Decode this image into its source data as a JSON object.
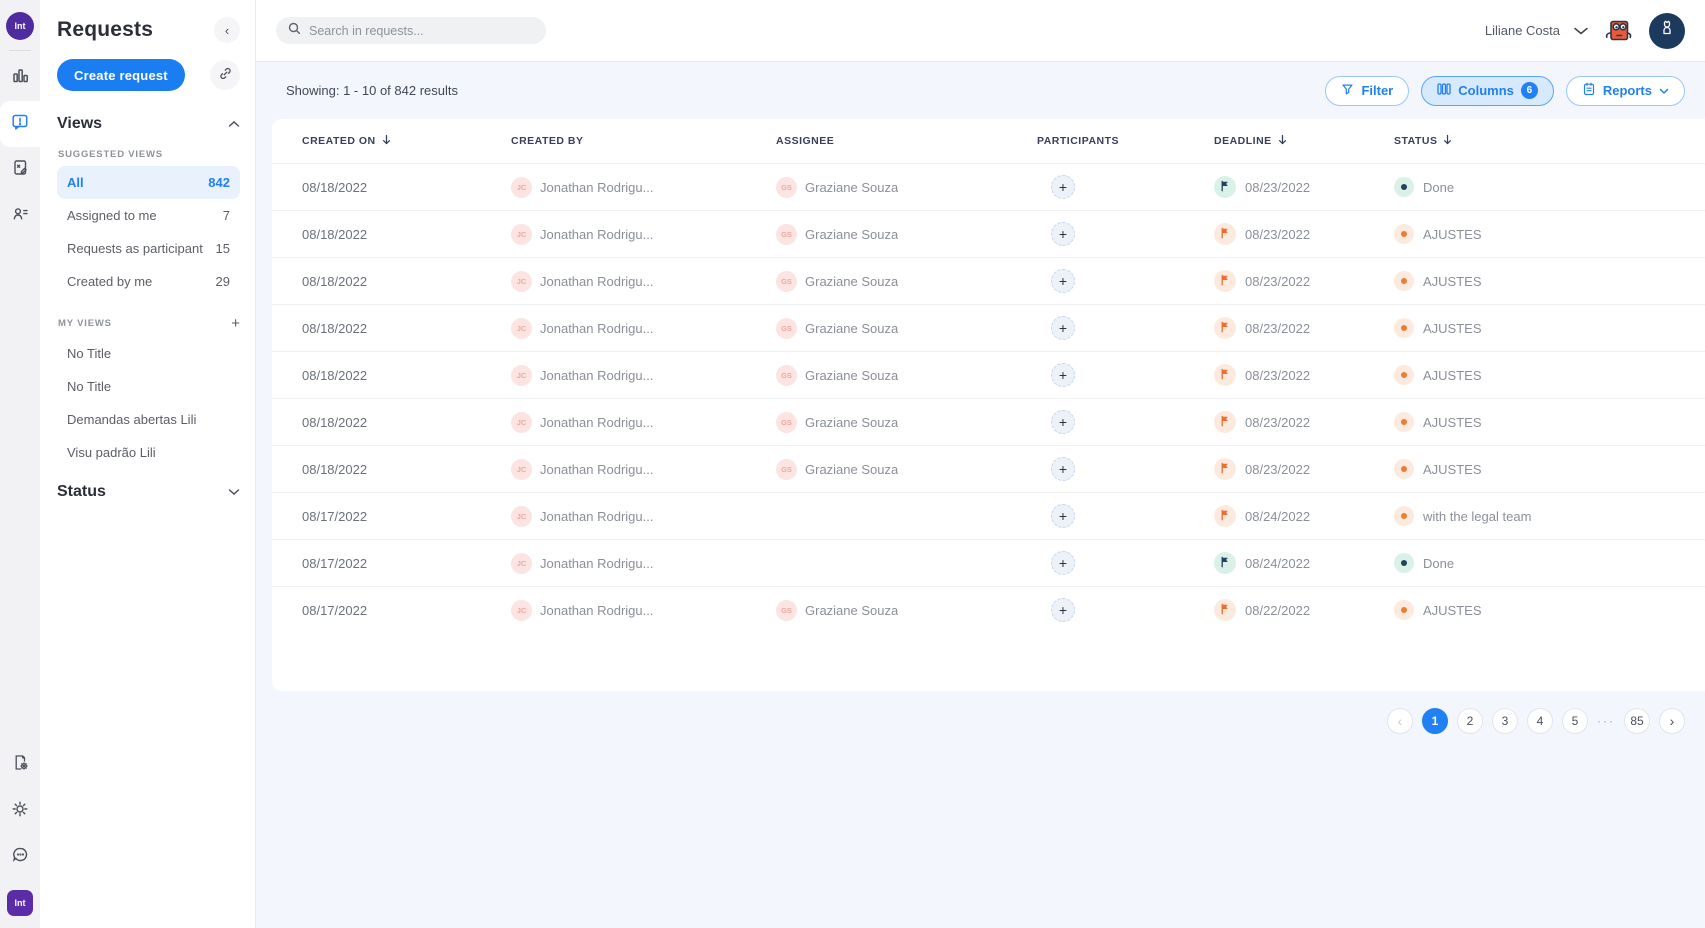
{
  "brand": {
    "logo_text": "lnt"
  },
  "rail": {
    "items": [
      {
        "icon": "bar-chart-icon",
        "active": false
      },
      {
        "icon": "requests-bubble-icon",
        "active": true
      },
      {
        "icon": "document-edit-icon",
        "active": false
      },
      {
        "icon": "contacts-icon",
        "active": false
      }
    ],
    "bottom_items": [
      {
        "icon": "document-gear-icon"
      },
      {
        "icon": "gear-icon"
      },
      {
        "icon": "chat-dots-icon"
      }
    ]
  },
  "sidebar": {
    "title": "Requests",
    "collapse_icon": "‹",
    "create_button": "Create request",
    "views_heading": "Views",
    "suggested_views_label": "SUGGESTED VIEWS",
    "suggested_views": [
      {
        "label": "All",
        "count": "842",
        "active": true
      },
      {
        "label": "Assigned to me",
        "count": "7",
        "active": false
      },
      {
        "label": "Requests as participant",
        "count": "15",
        "active": false
      },
      {
        "label": "Created by me",
        "count": "29",
        "active": false
      }
    ],
    "my_views_label": "MY VIEWS",
    "my_views_add": "+",
    "my_views": [
      "No Title",
      "No Title",
      "Demandas abertas Lili",
      "Visu padrão Lili"
    ],
    "status_heading": "Status"
  },
  "topbar": {
    "search_placeholder": "Search in requests...",
    "user_name": "Liliane Costa"
  },
  "toolbar": {
    "showing_text": "Showing: 1 - 10 of 842 results",
    "filter_label": "Filter",
    "columns_label": "Columns",
    "columns_count": "6",
    "reports_label": "Reports"
  },
  "table": {
    "columns": [
      {
        "label": "CREATED ON",
        "sortable": true
      },
      {
        "label": "CREATED BY",
        "sortable": false
      },
      {
        "label": "ASSIGNEE",
        "sortable": false
      },
      {
        "label": "PARTICIPANTS",
        "sortable": false
      },
      {
        "label": "DEADLINE",
        "sortable": true
      },
      {
        "label": "STATUS",
        "sortable": true
      }
    ],
    "rows": [
      {
        "created_on": "08/18/2022",
        "created_by": {
          "initials": "JC",
          "name": "Jonathan Rodrigu..."
        },
        "assignee": {
          "initials": "GS",
          "name": "Graziane Souza"
        },
        "deadline": "08/23/2022",
        "status": {
          "label": "Done",
          "type": "done"
        }
      },
      {
        "created_on": "08/18/2022",
        "created_by": {
          "initials": "JC",
          "name": "Jonathan Rodrigu..."
        },
        "assignee": {
          "initials": "GS",
          "name": "Graziane Souza"
        },
        "deadline": "08/23/2022",
        "status": {
          "label": "AJUSTES",
          "type": "orange"
        }
      },
      {
        "created_on": "08/18/2022",
        "created_by": {
          "initials": "JC",
          "name": "Jonathan Rodrigu..."
        },
        "assignee": {
          "initials": "GS",
          "name": "Graziane Souza"
        },
        "deadline": "08/23/2022",
        "status": {
          "label": "AJUSTES",
          "type": "orange"
        }
      },
      {
        "created_on": "08/18/2022",
        "created_by": {
          "initials": "JC",
          "name": "Jonathan Rodrigu..."
        },
        "assignee": {
          "initials": "GS",
          "name": "Graziane Souza"
        },
        "deadline": "08/23/2022",
        "status": {
          "label": "AJUSTES",
          "type": "orange"
        }
      },
      {
        "created_on": "08/18/2022",
        "created_by": {
          "initials": "JC",
          "name": "Jonathan Rodrigu..."
        },
        "assignee": {
          "initials": "GS",
          "name": "Graziane Souza"
        },
        "deadline": "08/23/2022",
        "status": {
          "label": "AJUSTES",
          "type": "orange"
        }
      },
      {
        "created_on": "08/18/2022",
        "created_by": {
          "initials": "JC",
          "name": "Jonathan Rodrigu..."
        },
        "assignee": {
          "initials": "GS",
          "name": "Graziane Souza"
        },
        "deadline": "08/23/2022",
        "status": {
          "label": "AJUSTES",
          "type": "orange"
        }
      },
      {
        "created_on": "08/18/2022",
        "created_by": {
          "initials": "JC",
          "name": "Jonathan Rodrigu..."
        },
        "assignee": {
          "initials": "GS",
          "name": "Graziane Souza"
        },
        "deadline": "08/23/2022",
        "status": {
          "label": "AJUSTES",
          "type": "orange"
        }
      },
      {
        "created_on": "08/17/2022",
        "created_by": {
          "initials": "JC",
          "name": "Jonathan Rodrigu..."
        },
        "assignee": null,
        "deadline": "08/24/2022",
        "status": {
          "label": "with the legal team",
          "type": "orange"
        }
      },
      {
        "created_on": "08/17/2022",
        "created_by": {
          "initials": "JC",
          "name": "Jonathan Rodrigu..."
        },
        "assignee": null,
        "deadline": "08/24/2022",
        "status": {
          "label": "Done",
          "type": "done"
        }
      },
      {
        "created_on": "08/17/2022",
        "created_by": {
          "initials": "JC",
          "name": "Jonathan Rodrigu..."
        },
        "assignee": {
          "initials": "GS",
          "name": "Graziane Souza"
        },
        "deadline": "08/22/2022",
        "status": {
          "label": "AJUSTES",
          "type": "orange"
        }
      }
    ]
  },
  "pagination": {
    "prev_icon": "‹",
    "next_icon": "›",
    "pages": [
      "1",
      "2",
      "3",
      "4",
      "5"
    ],
    "ellipsis": "···",
    "last_page": "85",
    "active_page": "1"
  },
  "colors": {
    "primary_blue": "#2180f3",
    "brand_purple": "#4e2b9e",
    "status_orange": "#ed7d31",
    "status_orange_tint": "#fdeade",
    "status_done_navy": "#26415e",
    "status_done_tint": "#d9f1e6",
    "avatar_pink_bg": "#fbe4e1",
    "avatar_pink_text": "#eda99f",
    "navy_avatar_bg": "#1c3a5e",
    "content_bg": "#f3f6fc"
  }
}
